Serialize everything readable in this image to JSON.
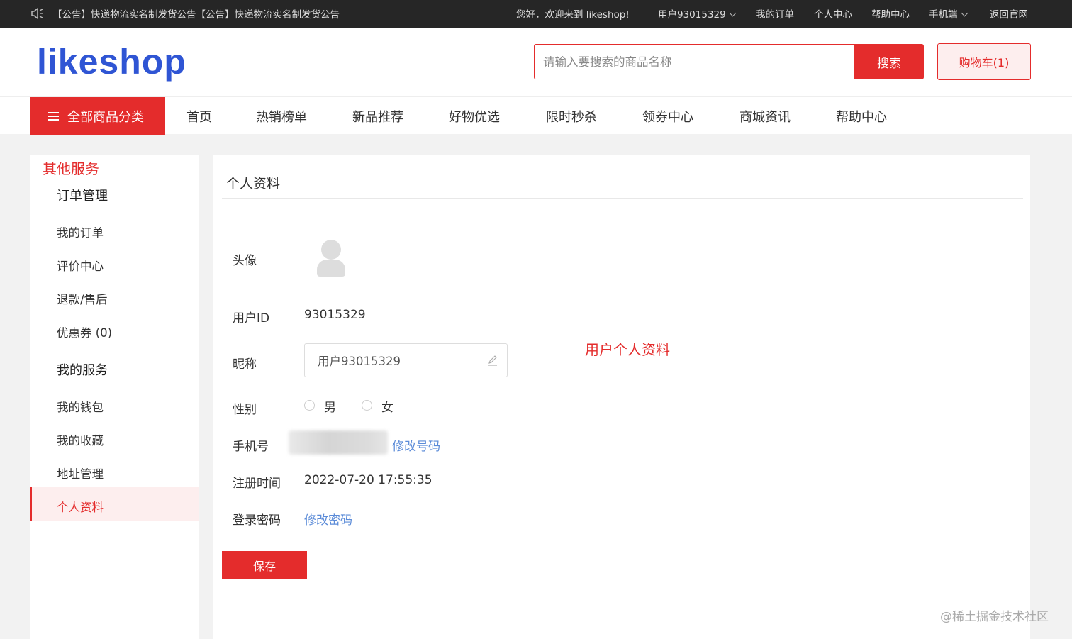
{
  "topbar": {
    "notice": "【公告】快递物流实名制发货公告【公告】快递物流实名制发货公告",
    "welcome": "您好，欢迎来到 likeshop!",
    "user": "用户93015329",
    "my_orders": "我的订单",
    "personal_center": "个人中心",
    "help_center": "帮助中心",
    "mobile": "手机端",
    "back_home": "返回官网"
  },
  "header": {
    "logo": "likeshop",
    "search_placeholder": "请输入要搜索的商品名称",
    "search_button": "搜索",
    "cart_button": "购物车(1)"
  },
  "nav": {
    "all_categories": "全部商品分类",
    "items": [
      "首页",
      "热销榜单",
      "新品推荐",
      "好物优选",
      "限时秒杀",
      "领券中心",
      "商城资讯",
      "帮助中心"
    ]
  },
  "sidebar": {
    "section_title": "其他服务",
    "group1_title": "订单管理",
    "group1_items": [
      "我的订单",
      "评价中心",
      "退款/售后",
      "优惠券 (0)"
    ],
    "group2_title": "我的服务",
    "group2_items": [
      "我的钱包",
      "我的收藏",
      "地址管理",
      "个人资料"
    ]
  },
  "profile": {
    "title": "个人资料",
    "avatar_label": "头像",
    "user_id_label": "用户ID",
    "user_id": "93015329",
    "nickname_label": "昵称",
    "nickname": "用户93015329",
    "gender_label": "性别",
    "gender_male": "男",
    "gender_female": "女",
    "phone_label": "手机号",
    "change_phone": "修改号码",
    "register_label": "注册时间",
    "register_time": "2022-07-20 17:55:35",
    "password_label": "登录密码",
    "change_password": "修改密码",
    "annotation": "用户个人资料",
    "save_button": "保存"
  },
  "watermark": "@稀土掘金技术社区",
  "colors": {
    "accent": "#e42c2c",
    "topbar_bg": "#262626",
    "link": "#5b8bd8",
    "logo": "#2f55d4"
  }
}
